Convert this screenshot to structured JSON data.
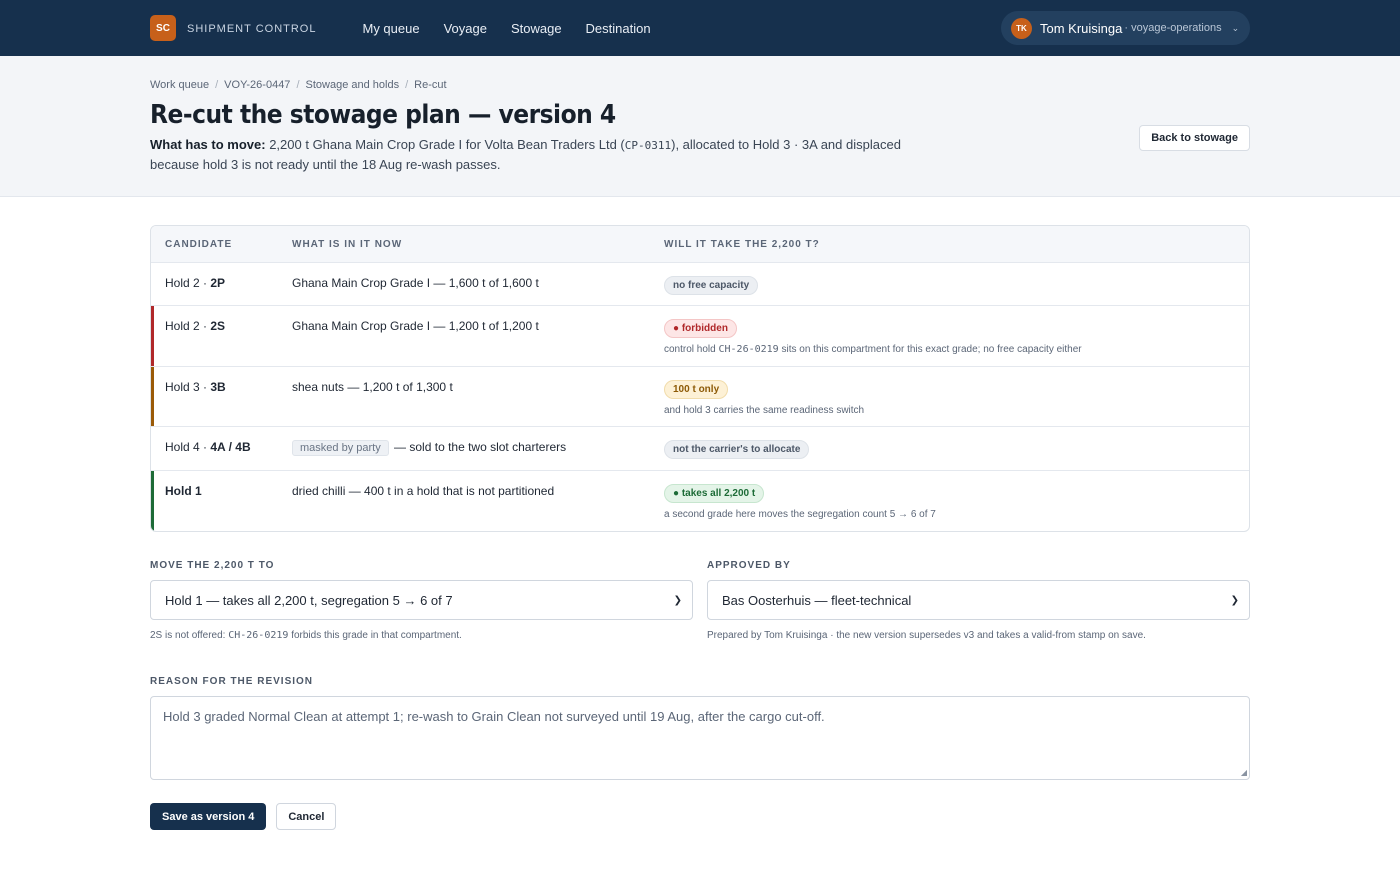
{
  "nav": {
    "logo": "SC",
    "brand": "SHIPMENT CONTROL",
    "links": [
      "My queue",
      "Voyage",
      "Stowage",
      "Destination"
    ]
  },
  "user": {
    "initials": "TK",
    "name": "Tom Kruisinga",
    "role": "· voyage-operations"
  },
  "breadcrumb": [
    "Work queue",
    "VOY-26-0447",
    "Stowage and holds",
    "Re-cut"
  ],
  "page": {
    "title": "Re-cut the stowage plan — version 4",
    "lede_label": "What has to move:",
    "lede_a": "2,200 t Ghana Main Crop Grade I for Volta Bean Traders Ltd (",
    "lede_code": "CP-0311",
    "lede_b": "), allocated to Hold 3 · 3A and displaced because hold 3 is not ready until the 18 Aug re-wash passes.",
    "back": "Back to stowage"
  },
  "table": {
    "headers": [
      "CANDIDATE",
      "WHAT IS IN IT NOW",
      "WILL IT TAKE THE 2,200 T?"
    ],
    "rows": [
      {
        "hold": "Hold 2 ·",
        "cmp": "2P",
        "now": "Ghana Main Crop Grade I — 1,600 t of 1,600 t",
        "pill": "no free capacity",
        "tone": "gray",
        "bar": "",
        "note": "",
        "note_code": "",
        "note_b": ""
      },
      {
        "hold": "Hold 2 ·",
        "cmp": "2S",
        "now": "Ghana Main Crop Grade I — 1,200 t of 1,200 t",
        "pill": "● forbidden",
        "tone": "red",
        "bar": "#b0282a",
        "note": "control hold ",
        "note_code": "CH-26-0219",
        "note_b": " sits on this compartment for this exact grade; no free capacity either"
      },
      {
        "hold": "Hold 3 ·",
        "cmp": "3B",
        "now": "shea nuts — 1,200 t of 1,300 t",
        "pill": "100 t only",
        "tone": "amber",
        "bar": "#9a5a08",
        "note": "and hold 3 carries the same readiness switch",
        "note_code": "",
        "note_b": ""
      },
      {
        "hold": "Hold 4 ·",
        "cmp": "4A / 4B",
        "mask": "masked by party",
        "now": "— sold to the two slot charterers",
        "pill": "not the carrier's to allocate",
        "tone": "gray",
        "bar": "",
        "note": "",
        "note_code": "",
        "note_b": ""
      },
      {
        "hold": "Hold 1",
        "cmp": "",
        "now": "dried chilli — 400 t in a hold that is not partitioned",
        "pill": "● takes all 2,200 t",
        "tone": "green",
        "bar": "#1d6b37",
        "note": "a second grade here moves the segregation count 5 → 6 of 7",
        "note_code": "",
        "note_b": ""
      }
    ]
  },
  "move": {
    "label": "MOVE THE 2,200 T TO",
    "value": "Hold 1 — takes all 2,200 t, segregation 5 → 6 of 7",
    "help_a": "2S is not offered: ",
    "help_code": "CH-26-0219",
    "help_b": " forbids this grade in that compartment."
  },
  "approver": {
    "label": "APPROVED BY",
    "value": "Bas Oosterhuis — fleet-technical",
    "help": "Prepared by Tom Kruisinga · the new version supersedes v3 and takes a valid-from stamp on save."
  },
  "reason": {
    "label": "REASON FOR THE REVISION",
    "value": "Hold 3 graded Normal Clean at attempt 1; re-wash to Grain Clean not surveyed until 19 Aug, after the cargo cut-off."
  },
  "actions": {
    "save": "Save as version 4",
    "cancel": "Cancel"
  }
}
